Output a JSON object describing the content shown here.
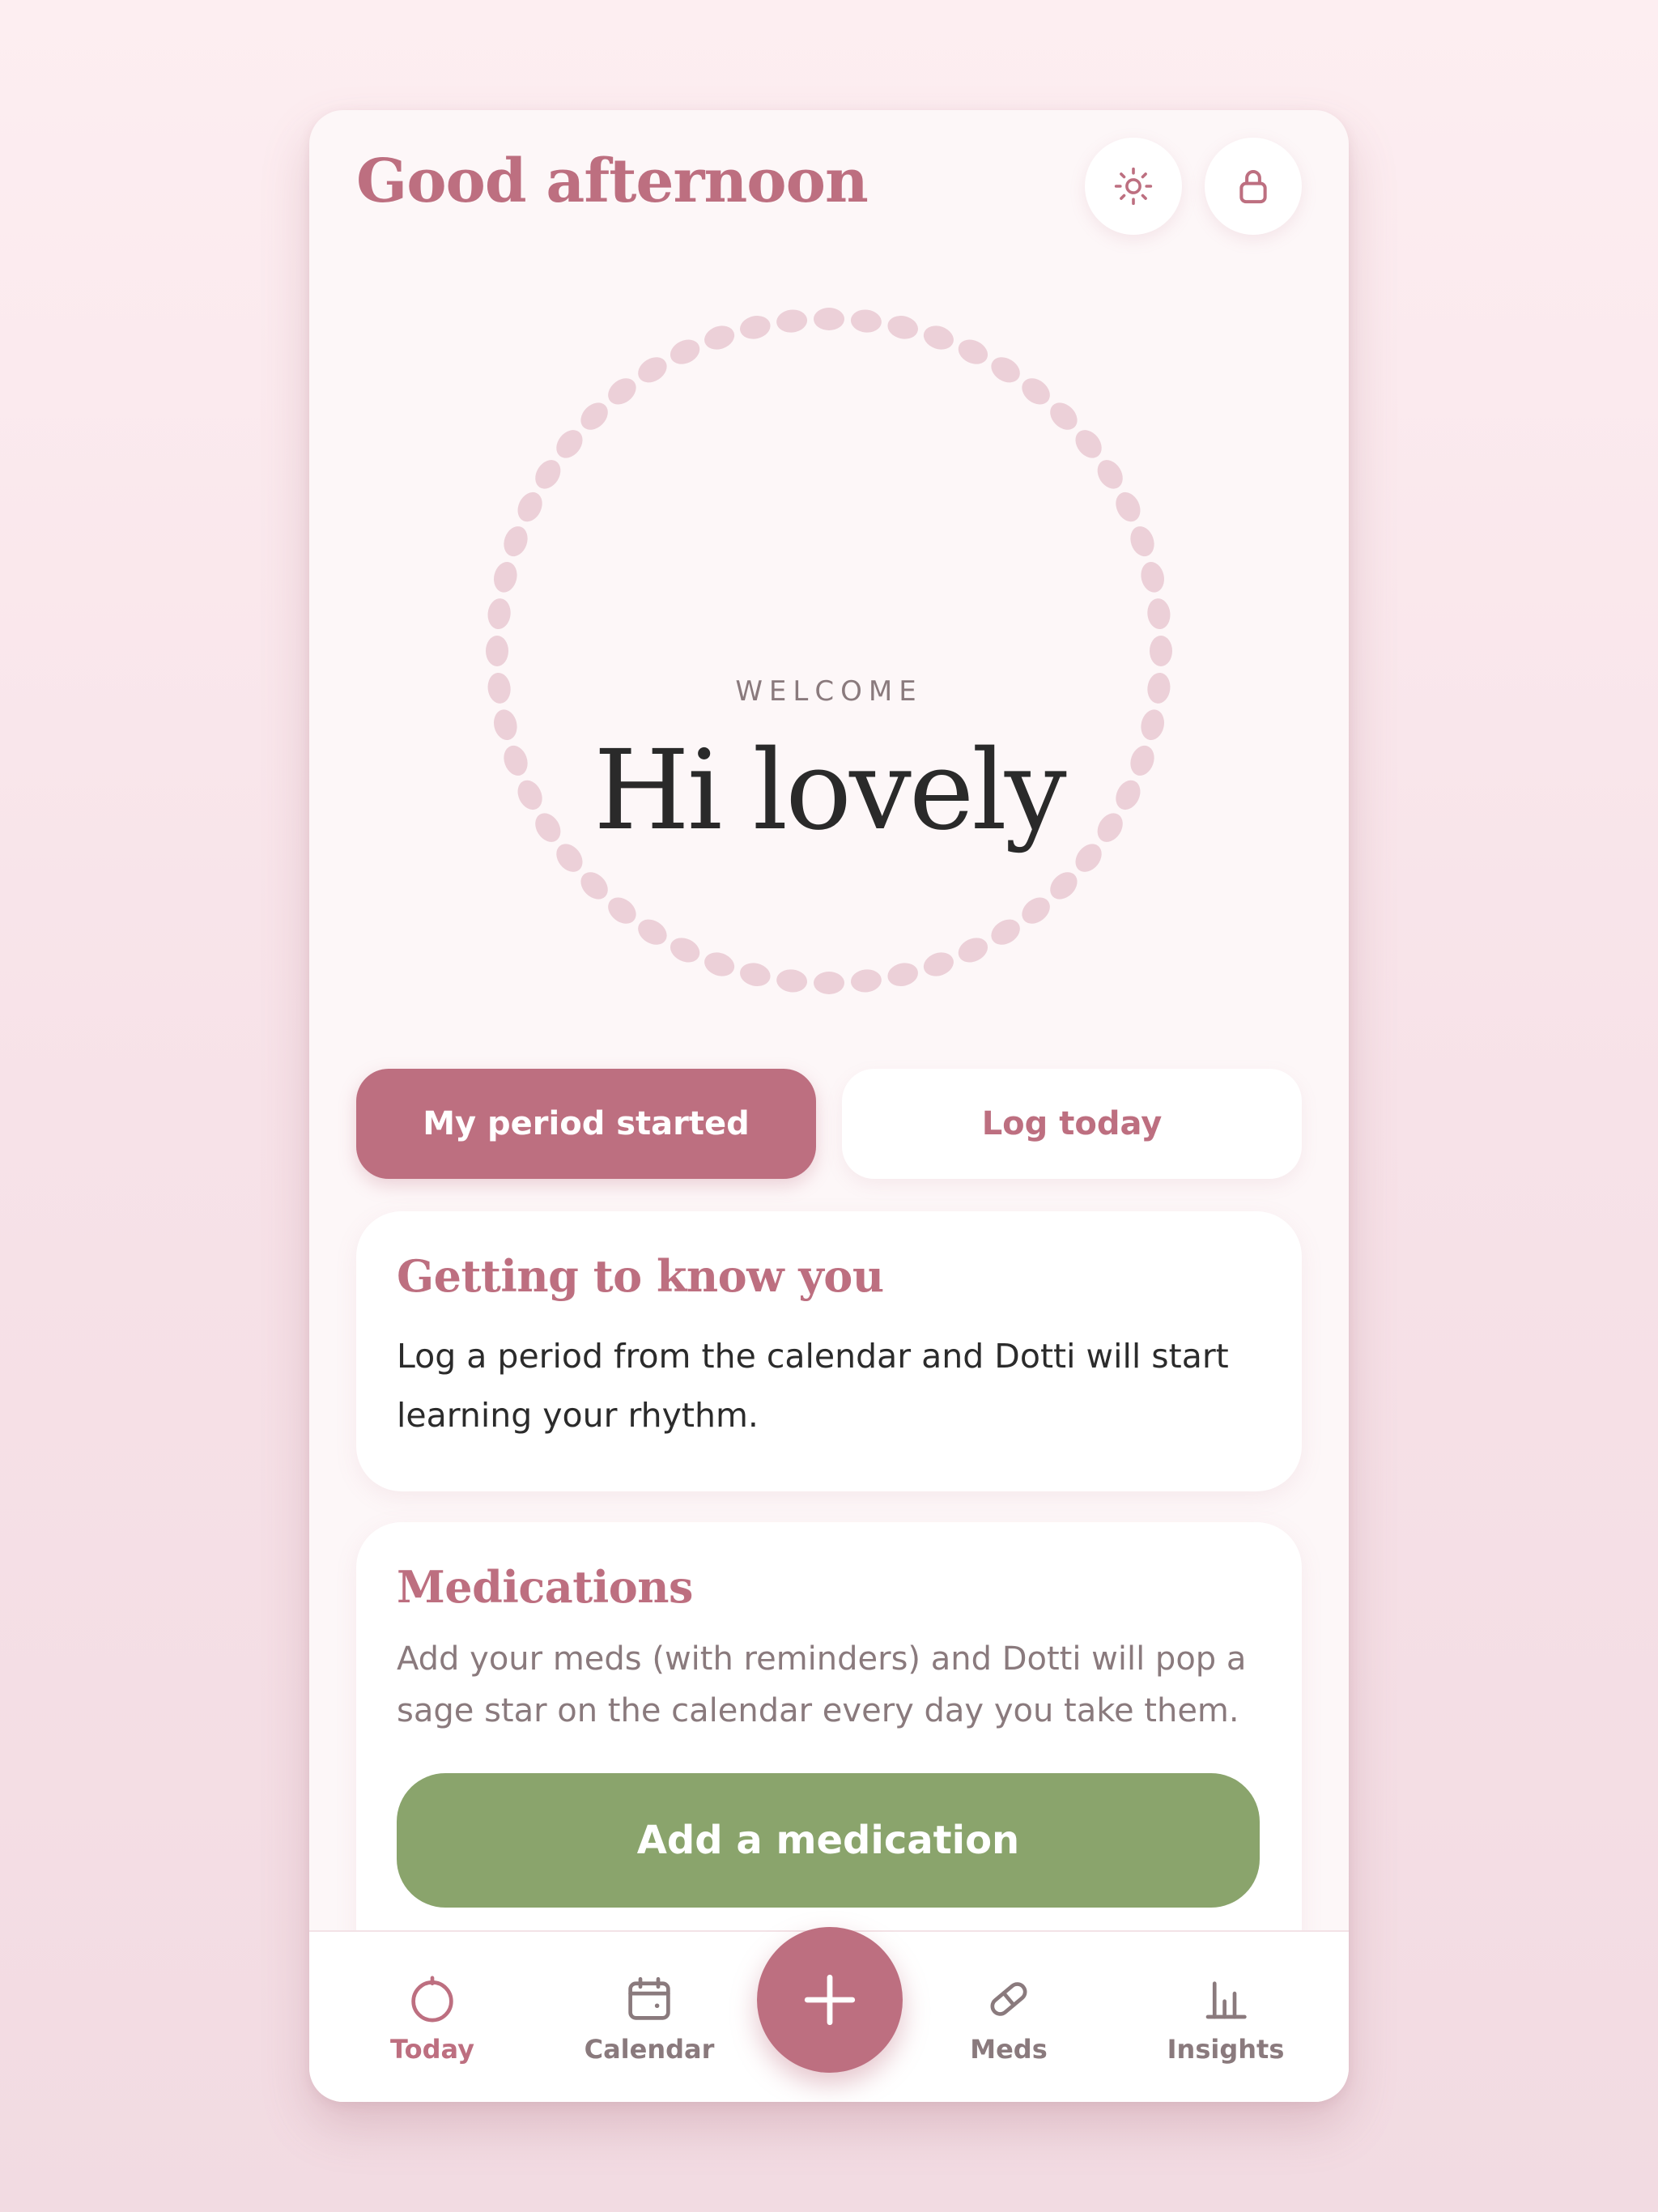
{
  "header": {
    "greeting": "Good afternoon",
    "theme_icon": "sun-icon",
    "lock_icon": "lock-icon"
  },
  "hero": {
    "label": "WELCOME",
    "title": "Hi lovely"
  },
  "actions": {
    "primary_label": "My period started",
    "secondary_label": "Log today"
  },
  "cards": {
    "know": {
      "title": "Getting to know you",
      "body_line1": "Log a period from the calendar and Dotti will start",
      "body_line2": "learning your rhythm."
    },
    "medications": {
      "title": "Medications",
      "body_line1": "Add your meds (with reminders) and Dotti will pop a",
      "body_line2": "sage star on the calendar every day you take them.",
      "button_label": "Add a medication"
    }
  },
  "tabbar": {
    "tabs": [
      {
        "label": "Today",
        "icon": "circle-icon",
        "active": true
      },
      {
        "label": "Calendar",
        "icon": "calendar-icon",
        "active": false
      },
      {
        "label": "Meds",
        "icon": "pill-icon",
        "active": false
      },
      {
        "label": "Insights",
        "icon": "bar-chart-icon",
        "active": false
      }
    ],
    "fab_icon": "plus-icon"
  },
  "colors": {
    "accent": "#bd6f80",
    "sage": "#8aa46c",
    "ring_dots": "#ecd0d8",
    "background": "#fdf7f8",
    "text_dark": "#2a2a2a",
    "text_muted": "#8a7a7d"
  }
}
